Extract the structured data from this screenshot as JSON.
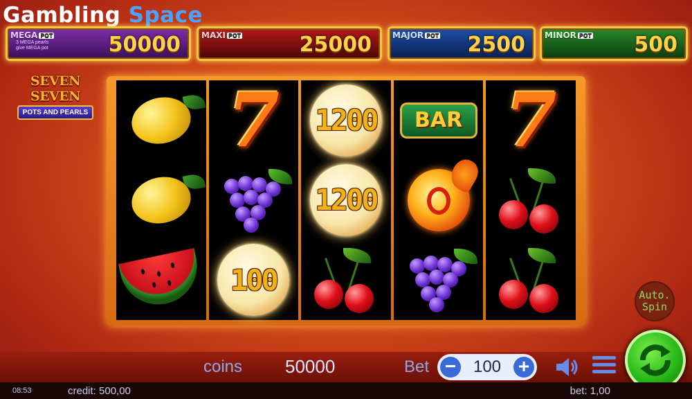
{
  "logo": {
    "part1": "Gambling",
    "part2": "Space"
  },
  "jackpots": {
    "mega": {
      "label": "MEGA",
      "suffix": "POT",
      "value": "50000",
      "note_line1": "3 MEGA pearls",
      "note_line2": "give MEGA pot"
    },
    "maxi": {
      "label": "MAXI",
      "suffix": "POT",
      "value": "25000"
    },
    "major": {
      "label": "MAJOR",
      "suffix": "POT",
      "value": "2500"
    },
    "minor": {
      "label": "MINOR",
      "suffix": "POT",
      "value": "500"
    }
  },
  "game_title": {
    "line1": "SEVEN SEVEN",
    "line2": "POTS AND PEARLS"
  },
  "reels": [
    [
      "lemon",
      "lemon",
      "watermelon"
    ],
    [
      "seven",
      "grapes",
      "pearl-100"
    ],
    [
      "pearl-1200",
      "pearl-1200",
      "cherries"
    ],
    [
      "bar",
      "fireball",
      "grapes"
    ],
    [
      "seven",
      "cherries",
      "cherries"
    ]
  ],
  "pearls": {
    "reel3_top": "1200",
    "reel3_mid": "1200",
    "reel2_bottom": "100"
  },
  "bar_symbol": "BAR",
  "seven_symbol": "7",
  "autospin": {
    "line1": "Auto.",
    "line2": "Spin"
  },
  "bottom": {
    "coins_label": "coins",
    "coins_value": "50000",
    "bet_label": "Bet",
    "bet_value": "100",
    "minus": "−",
    "plus": "+"
  },
  "status": {
    "time": "08:53",
    "credit": "credit: 500,00",
    "bet": "bet: 1,00"
  },
  "colors": {
    "accent_gold": "#f6c640",
    "spin_green": "#2aba1a",
    "stepper_blue": "#3a6ad8"
  }
}
